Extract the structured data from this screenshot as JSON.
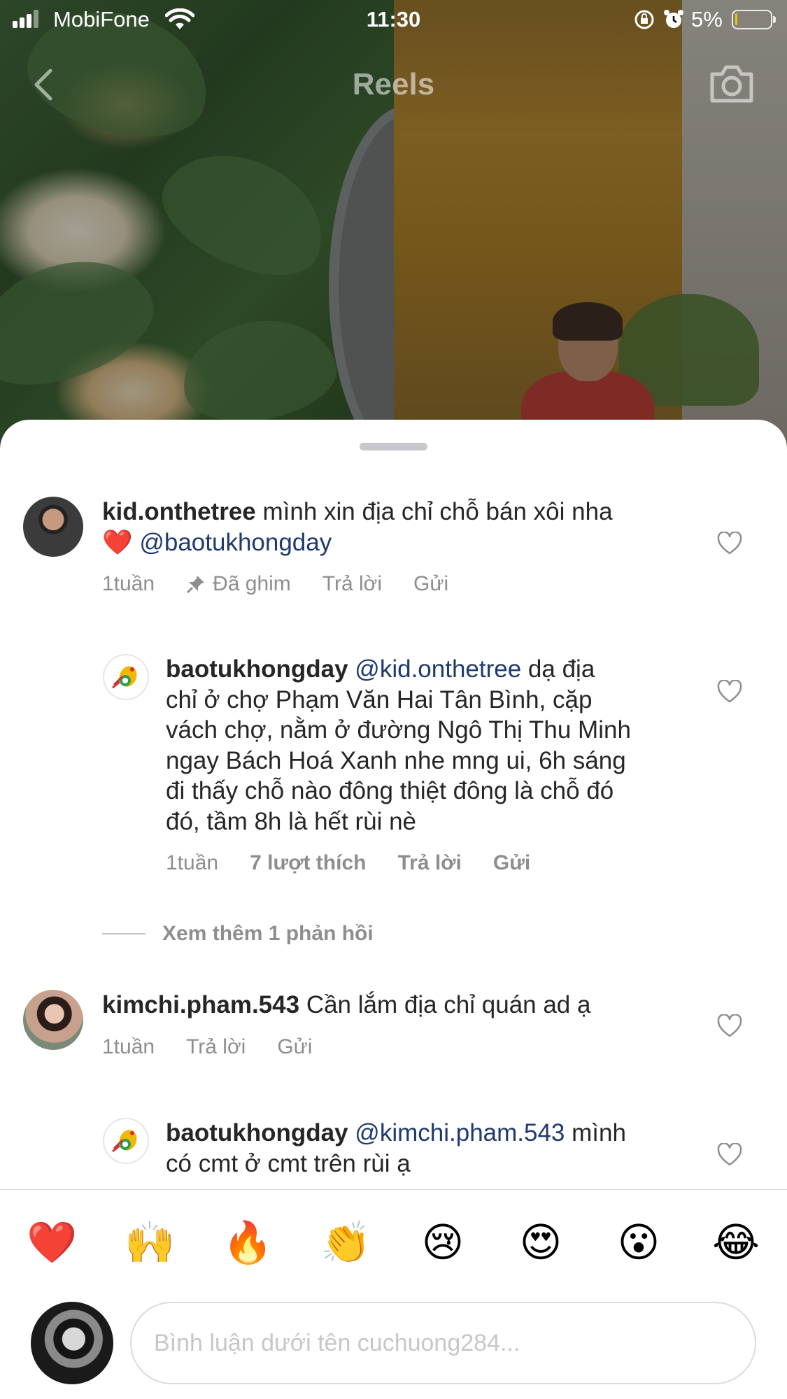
{
  "status_bar": {
    "carrier": "MobiFone",
    "time": "11:30",
    "battery": "5%",
    "battery_level_fraction": 0.05,
    "icons": [
      "signal-icon",
      "wifi-icon",
      "rotation-lock-icon",
      "alarm-icon",
      "battery-icon"
    ]
  },
  "header": {
    "title": "Reels",
    "back_icon": "chevron-left-icon",
    "camera_icon": "camera-icon"
  },
  "comments": [
    {
      "username": "kid.onthetree",
      "text": "mình xin địa chỉ chỗ bán xôi nha",
      "emoji": "❤️",
      "mention": "@baotukhongday",
      "time": "1tuần",
      "pinned_label": "Đã ghim",
      "reply_label": "Trả lời",
      "send_label": "Gửi",
      "liked": false
    },
    {
      "username": "baotukhongday",
      "mention": "@kid.onthetree",
      "lines": [
        "dạ địa",
        "chỉ ở chợ Phạm Văn Hai Tân Bình, cặp",
        "vách chợ, nằm ở đường Ngô Thị Thu Minh",
        "ngay Bách Hoá Xanh nhe mng ui, 6h sáng",
        "đi thấy chỗ nào đông thiệt đông là chỗ đó",
        "đó, tầm 8h là hết rùi nè"
      ],
      "time": "1tuần",
      "likes": "7 lượt thích",
      "reply_label": "Trả lời",
      "send_label": "Gửi",
      "liked": false
    },
    {
      "username": "kimchi.pham.543",
      "text": "Cần lắm địa chỉ quán ad ạ",
      "time": "1tuần",
      "reply_label": "Trả lời",
      "send_label": "Gửi",
      "liked": false
    },
    {
      "username": "baotukhongday",
      "mention": "@kimchi.pham.543",
      "lines": [
        "mình",
        "có cmt ở cmt trên rùi ạ"
      ],
      "liked": false
    }
  ],
  "more_replies": "Xem thêm 1 phản hồi",
  "reactions": [
    "❤️",
    "🙌",
    "🔥",
    "👏",
    "😢",
    "😍",
    "😮",
    "😂"
  ],
  "composer": {
    "placeholder": "Bình luận dưới tên cuchuong284..."
  }
}
